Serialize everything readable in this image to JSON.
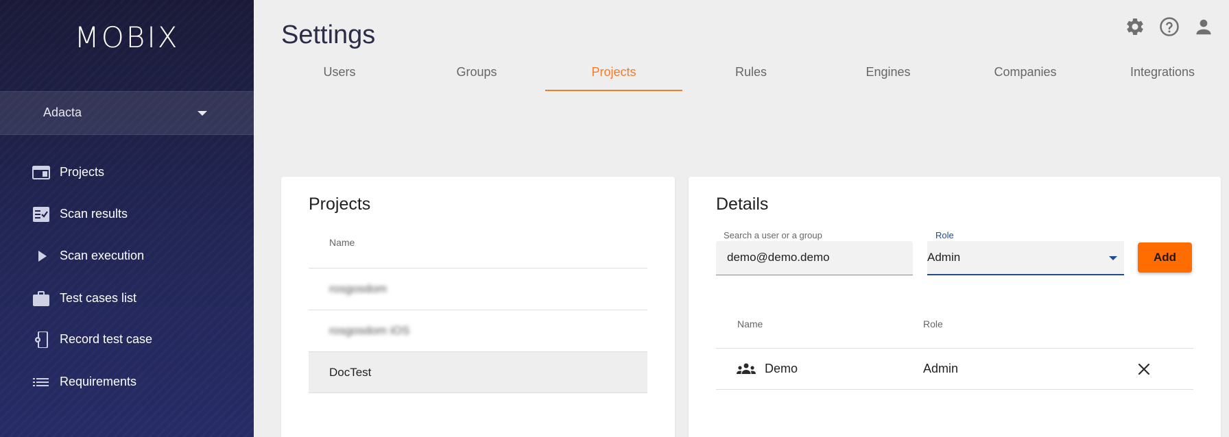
{
  "app": {
    "logo": "MOBIX"
  },
  "sidebar": {
    "company": "Adacta",
    "items": [
      {
        "label": "Projects",
        "icon": "projects-icon"
      },
      {
        "label": "Scan results",
        "icon": "scan-results-icon"
      },
      {
        "label": "Scan execution",
        "icon": "play-icon"
      },
      {
        "label": "Test cases list",
        "icon": "briefcase-icon"
      },
      {
        "label": "Record test case",
        "icon": "record-device-icon"
      },
      {
        "label": "Requirements",
        "icon": "list-icon"
      }
    ]
  },
  "header": {
    "title": "Settings",
    "icons": [
      "gear-icon",
      "help-icon",
      "account-icon"
    ]
  },
  "tabs": [
    {
      "label": "Users",
      "active": false
    },
    {
      "label": "Groups",
      "active": false
    },
    {
      "label": "Projects",
      "active": true
    },
    {
      "label": "Rules",
      "active": false
    },
    {
      "label": "Engines",
      "active": false
    },
    {
      "label": "Companies",
      "active": false
    },
    {
      "label": "Integrations",
      "active": false
    }
  ],
  "projects_card": {
    "title": "Projects",
    "column_name": "Name",
    "rows": [
      {
        "name": "rosgosdom",
        "blurred": true,
        "selected": false
      },
      {
        "name": "rosgosdom iOS",
        "blurred": true,
        "selected": false
      },
      {
        "name": "DocTest",
        "blurred": false,
        "selected": true
      }
    ]
  },
  "details_card": {
    "title": "Details",
    "search": {
      "label": "Search a user or a group",
      "value": "demo@demo.demo"
    },
    "role": {
      "label": "Role",
      "value": "Admin"
    },
    "add_label": "Add",
    "columns": {
      "name": "Name",
      "role": "Role"
    },
    "members": [
      {
        "name": "Demo",
        "role": "Admin",
        "icon": "group-icon"
      }
    ]
  },
  "colors": {
    "accent": "#f47b2b",
    "button": "#ff6d00",
    "sidebar": "#1e2150",
    "focus": "#1e4a8f"
  }
}
